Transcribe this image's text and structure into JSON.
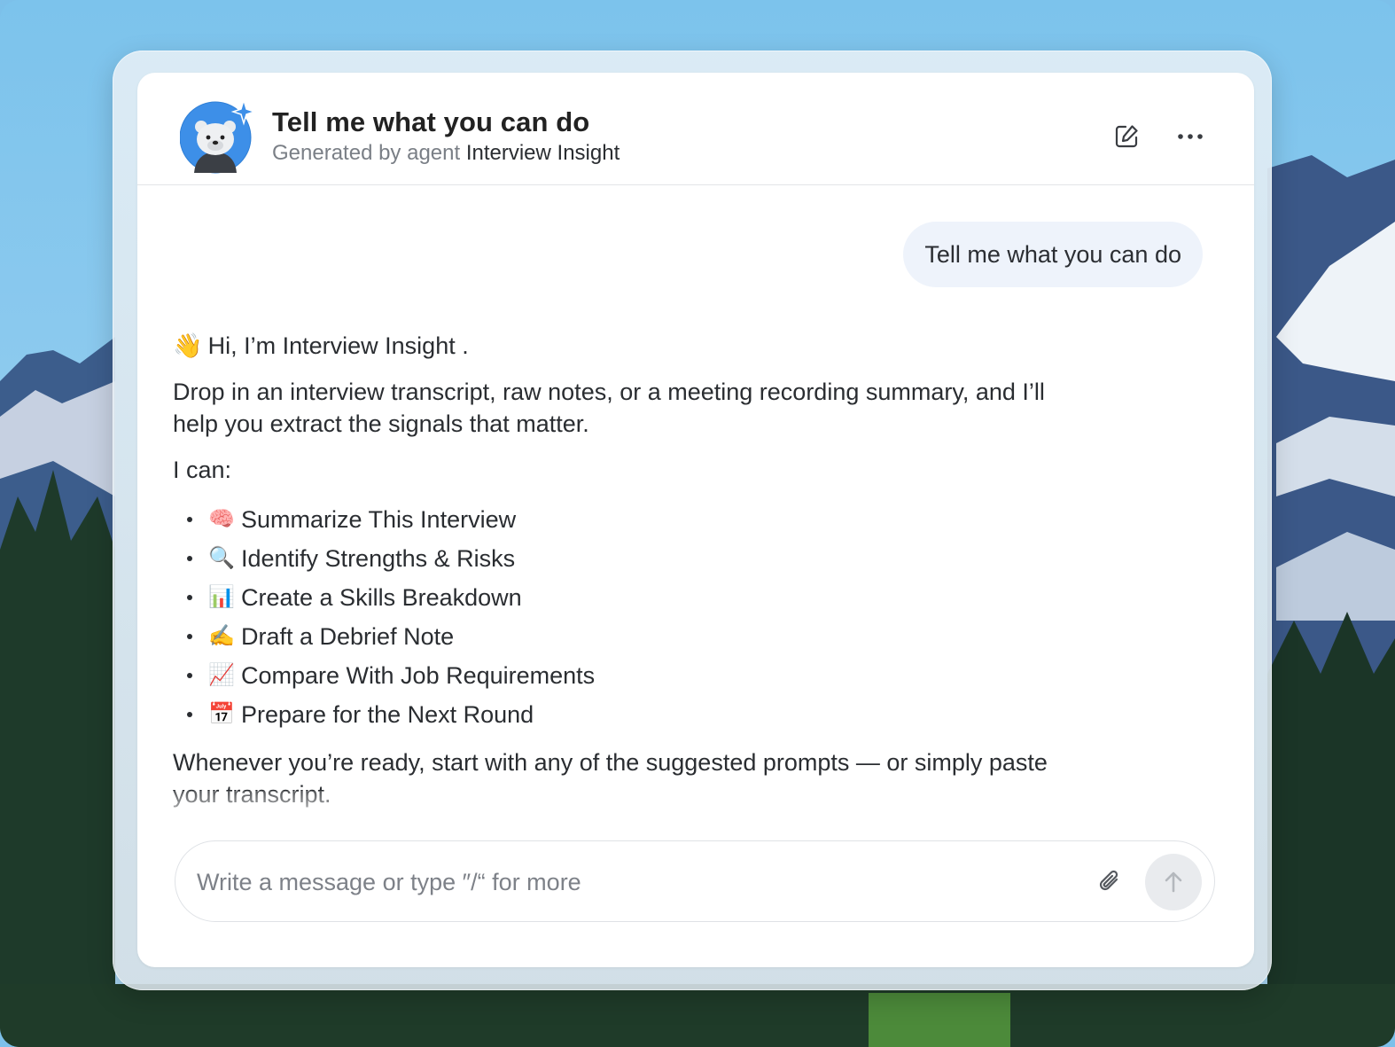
{
  "colors": {
    "accent": "#3d8fe8",
    "user_bubble": "#eef3fb",
    "muted_text": "#7a7f86"
  },
  "header": {
    "title": "Tell me what you can do",
    "subtitle_prefix": "Generated by agent",
    "agent_name": "Interview Insight",
    "edit_icon": "edit-icon",
    "more_icon": "more-icon"
  },
  "conversation": {
    "user_message": "Tell me what you can do",
    "greeting_emoji": "👋",
    "greeting": "Hi, I’m Interview Insight .",
    "intro": "Drop in an interview transcript, raw notes, or a meeting recording summary, and I’ll help you extract the signals that matter.",
    "can_label": "I can:",
    "capabilities": [
      {
        "emoji": "🧠",
        "label": "Summarize This Interview"
      },
      {
        "emoji": "🔍",
        "label": "Identify Strengths & Risks"
      },
      {
        "emoji": "📊",
        "label": "Create a Skills Breakdown"
      },
      {
        "emoji": "✍️",
        "label": "Draft a Debrief Note"
      },
      {
        "emoji": "📈",
        "label": "Compare With Job Requirements"
      },
      {
        "emoji": "📅",
        "label": "Prepare for the Next Round"
      }
    ],
    "closing": "Whenever you’re ready, start with any of the suggested prompts — or simply paste your transcript."
  },
  "composer": {
    "placeholder": "Write a message or type ″/“ for more",
    "attach_icon": "paperclip-icon",
    "send_icon": "arrow-up-icon"
  }
}
